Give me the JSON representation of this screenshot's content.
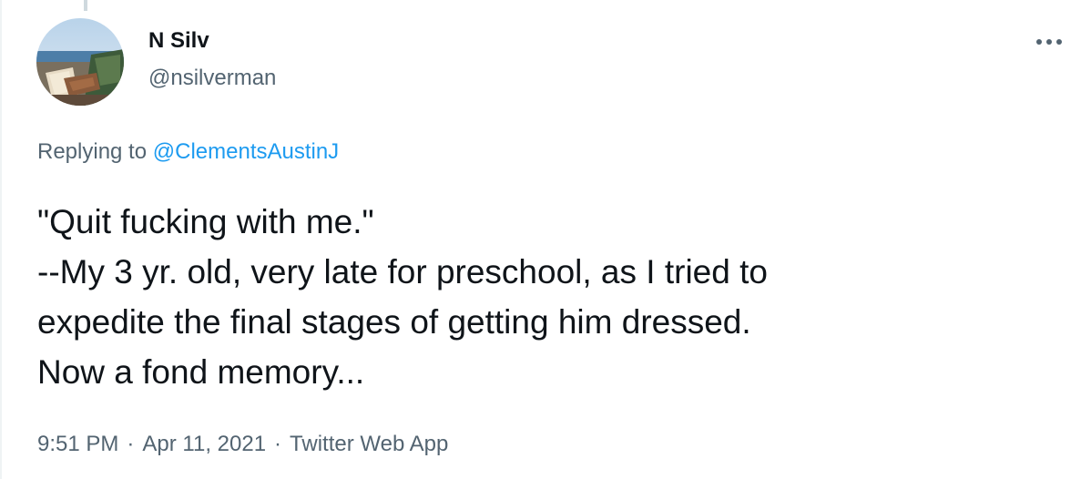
{
  "author": {
    "display_name": "N Silv",
    "handle": "@nsilverman",
    "avatar_icon": "avatar-photo"
  },
  "more_icon": "more-horizontal-icon",
  "reply": {
    "prefix": "Replying to",
    "mention": "@ClementsAustinJ"
  },
  "tweet": {
    "lines": [
      "\"Quit fucking with me.\"",
      "--My 3 yr. old, very late for preschool, as I tried to",
      "expedite the final stages of getting him dressed.",
      "Now a fond memory..."
    ]
  },
  "meta": {
    "time": "9:51 PM",
    "date": "Apr 11, 2021",
    "source": "Twitter Web App",
    "separator": "·"
  },
  "colors": {
    "text": "#0f1419",
    "secondary": "#536471",
    "link": "#1d9bf0"
  }
}
